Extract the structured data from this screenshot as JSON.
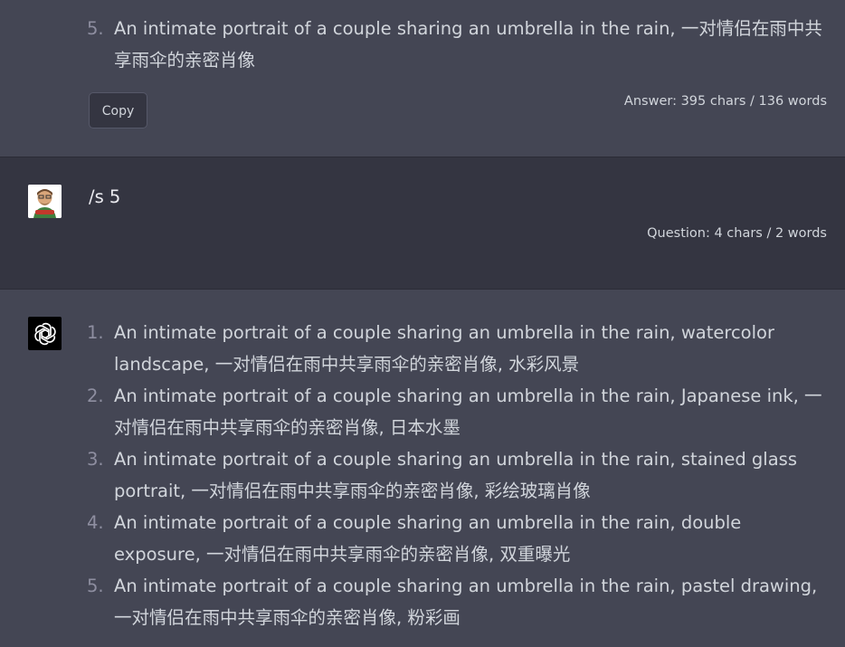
{
  "previous_answer": {
    "items": [
      {
        "num": "5.",
        "text": "An intimate portrait of a couple sharing an umbrella in the rain, 一对情侣在雨中共享雨伞的亲密肖像"
      }
    ],
    "copy_label": "Copy",
    "stats": "Answer: 395 chars / 136 words"
  },
  "user_message": {
    "text": "/s 5",
    "stats": "Question: 4 chars / 2 words"
  },
  "assistant_answer": {
    "items": [
      {
        "num": "1.",
        "text": "An intimate portrait of a couple sharing an umbrella in the rain, watercolor landscape, 一对情侣在雨中共享雨伞的亲密肖像, 水彩风景"
      },
      {
        "num": "2.",
        "text": "An intimate portrait of a couple sharing an umbrella in the rain, Japanese ink, 一对情侣在雨中共享雨伞的亲密肖像, 日本水墨"
      },
      {
        "num": "3.",
        "text": "An intimate portrait of a couple sharing an umbrella in the rain, stained glass portrait, 一对情侣在雨中共享雨伞的亲密肖像, 彩绘玻璃肖像"
      },
      {
        "num": "4.",
        "text": "An intimate portrait of a couple sharing an umbrella in the rain, double exposure, 一对情侣在雨中共享雨伞的亲密肖像, 双重曝光"
      },
      {
        "num": "5.",
        "text": "An intimate portrait of a couple sharing an umbrella in the rain, pastel drawing, 一对情侣在雨中共享雨伞的亲密肖像, 粉彩画"
      }
    ]
  },
  "icons": {
    "user_avatar": "user-avatar-icon",
    "assistant_avatar": "openai-logo-icon"
  },
  "colors": {
    "assistant_bg": "#444654",
    "user_bg": "#343541",
    "text": "#d1d5db",
    "list_number": "#8e8ea0"
  }
}
